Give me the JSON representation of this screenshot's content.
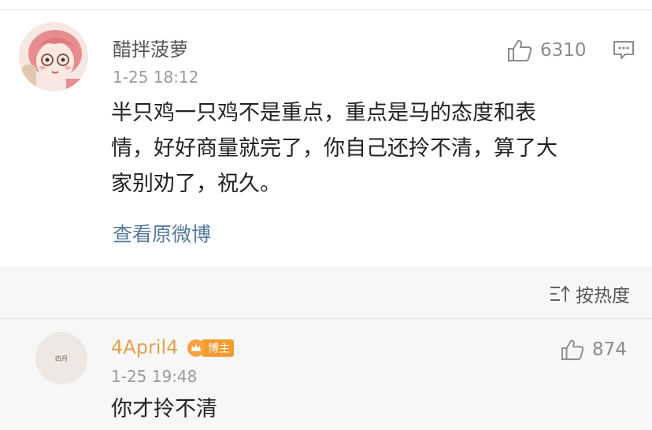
{
  "comment1": {
    "username": "醋拌菠萝",
    "time": "1-25 18:12",
    "likes": "6310",
    "content_lines": [
      "半只鸡一只鸡不是重点，重点是马的态度和表",
      "情，好好商量就完了，你自己还拎不清，算了大",
      "家别劝了，祝久。"
    ],
    "view_original": "查看原微博"
  },
  "sort": {
    "label": "按热度"
  },
  "reply1": {
    "username": "4April4",
    "badge": "博主",
    "avatar_text": "四月",
    "time": "1-25 19:48",
    "likes": "874",
    "content": "你才拎不清"
  },
  "colors": {
    "link": "#56789f",
    "badge": "#f29b2f",
    "reply_name": "#e2a14c"
  }
}
